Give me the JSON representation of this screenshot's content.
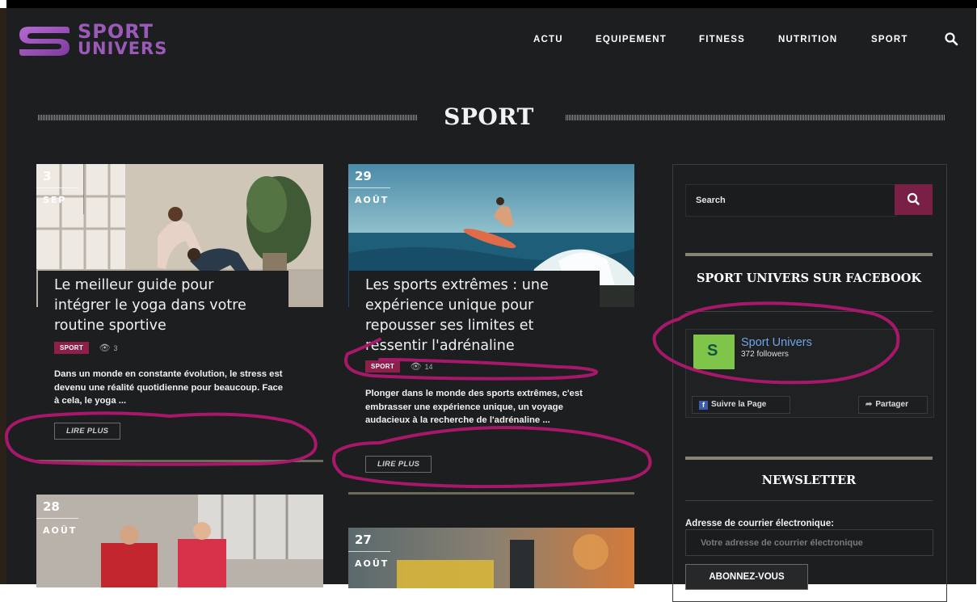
{
  "brand": {
    "line1": "SPORT",
    "line2": "UNIVERS",
    "color": "#9b5ab8"
  },
  "nav": {
    "items": [
      "ACTU",
      "EQUIPEMENT",
      "FITNESS",
      "NUTRITION",
      "SPORT"
    ],
    "search_icon": "search-icon"
  },
  "page": {
    "title": "SPORT"
  },
  "posts": [
    {
      "day": "3",
      "month": "SEP",
      "title": "Le meilleur guide pour intégrer le yoga dans votre routine sportive",
      "category": "SPORT",
      "views": "3",
      "excerpt": "Dans un monde en constante évolution, le stress est devenu une réalité quotidienne pour beaucoup. Face à cela, le yoga ...",
      "more": "LIRE PLUS"
    },
    {
      "day": "29",
      "month": "AOÛT",
      "title": "Les sports extrêmes : une expérience unique pour repousser ses limites et ressentir l'adrénaline",
      "category": "SPORT",
      "views": "14",
      "excerpt": "Plonger dans le monde des sports extrêmes, c'est embrasser une expérience unique, un voyage audacieux à la recherche de l'adrénaline ...",
      "more": "LIRE PLUS"
    },
    {
      "day": "28",
      "month": "AOÛT"
    },
    {
      "day": "27",
      "month": "AOÛT"
    }
  ],
  "sidebar": {
    "search_placeholder": "Search",
    "facebook": {
      "title": "SPORT UNIVERS SUR FACEBOOK",
      "page_name": "Sport Univers",
      "followers": "372 followers",
      "logo_letter": "S",
      "follow_label": "Suivre la Page",
      "share_label": "Partager"
    },
    "newsletter": {
      "title": "NEWSLETTER",
      "email_label": "Adresse de courrier électronique:",
      "email_placeholder": "Votre adresse de courrier électronique",
      "subscribe_label": "ABONNEZ-VOUS"
    }
  },
  "colors": {
    "background": "#1c1e20",
    "accent": "#7a1f45",
    "badge": "#8d1f4a",
    "annotation": "#a8186a"
  }
}
